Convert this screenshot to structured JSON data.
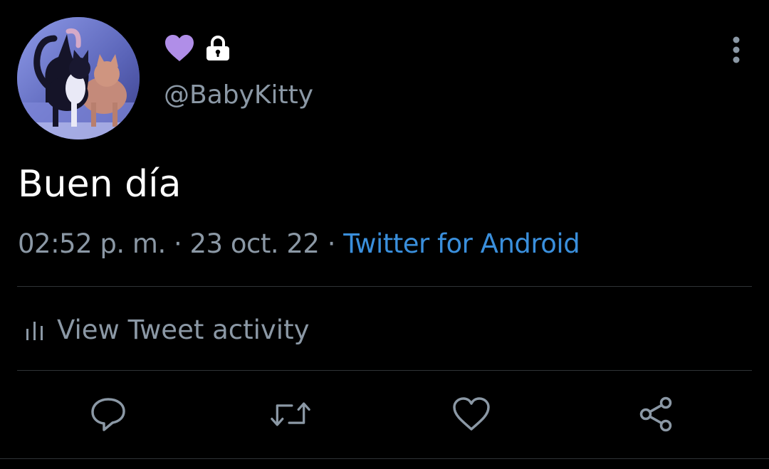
{
  "profile": {
    "handle": "@BabyKitty",
    "avatar_icon": "cats-photo-avatar",
    "badges": [
      {
        "icon": "purple-heart-icon",
        "color": "#b08ee8"
      },
      {
        "icon": "lock-icon",
        "color": "#ffffff"
      }
    ]
  },
  "tweet": {
    "text": "Buen día",
    "time": "02:52 p. m.",
    "separator": "·",
    "date": "23 oct. 22",
    "source": "Twitter for Android"
  },
  "activity": {
    "icon": "bar-chart-icon",
    "label": "View Tweet activity"
  },
  "actions": [
    {
      "name": "reply",
      "icon": "reply-icon"
    },
    {
      "name": "retweet",
      "icon": "retweet-icon"
    },
    {
      "name": "like",
      "icon": "heart-outline-icon"
    },
    {
      "name": "share",
      "icon": "share-icon"
    }
  ],
  "menu": {
    "icon": "more-vertical-icon"
  },
  "colors": {
    "background": "#000000",
    "primary_text": "#ffffff",
    "secondary_text": "#8b98a5",
    "link": "#3a8fdc",
    "divider": "#2f3336"
  }
}
